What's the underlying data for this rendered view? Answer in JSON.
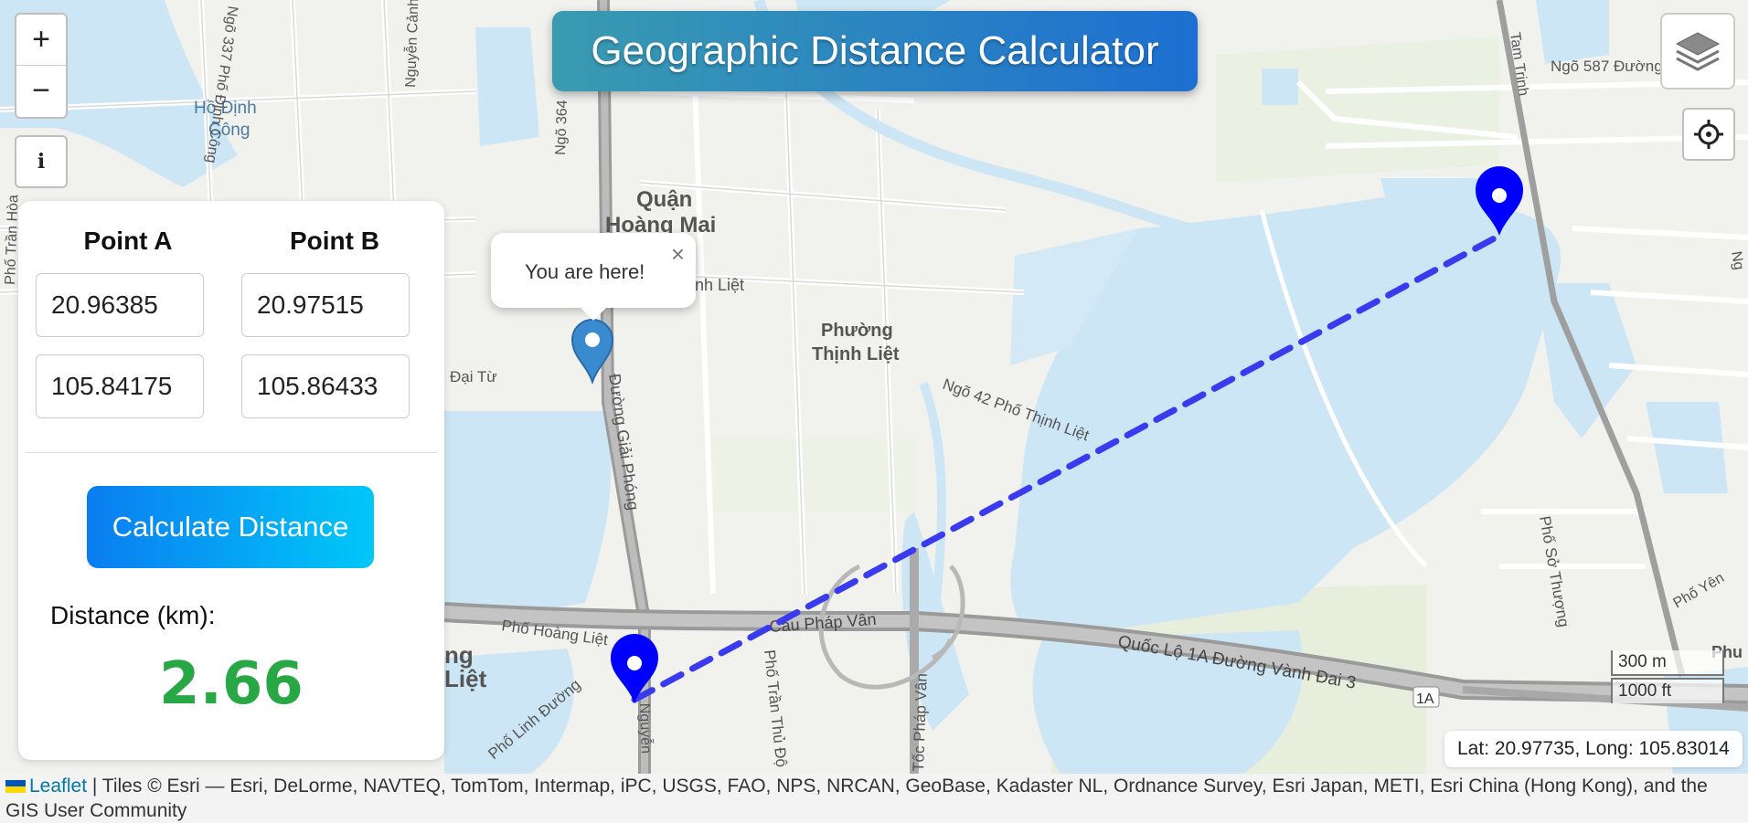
{
  "app": {
    "title": "Geographic Distance Calculator"
  },
  "map_controls": {
    "zoom_in": "+",
    "zoom_out": "−",
    "info": "i",
    "layers_icon": "layers-icon",
    "locate_icon": "crosshair-icon"
  },
  "form": {
    "point_a_label": "Point A",
    "point_b_label": "Point B",
    "point_a_lat": "20.96385",
    "point_a_lng": "105.84175",
    "point_b_lat": "20.97515",
    "point_b_lng": "105.86433",
    "calculate_label": "Calculate Distance",
    "distance_label": "Distance (km):",
    "distance_value": "2.66"
  },
  "popup": {
    "text": "You are here!",
    "close": "×"
  },
  "map_labels": {
    "quan_hoang_mai_1": "Quận",
    "quan_hoang_mai_2": "Hoàng Mai",
    "phuong_thinh_liet_1": "Phường",
    "phuong_thinh_liet_2": "Thịnh Liệt",
    "ho_dinh_cong_1": "Hồ Định",
    "ho_dinh_cong_2": "Công",
    "ngo_587": "Ngõ 587 Đường",
    "ngo_42": "Ngõ 42 Phố Thịnh Liệt",
    "duong_giai_phong": "Đường Giải Phóng",
    "cau_phap_van": "Cầu Pháp Vân",
    "quoc_lo_1a": "Quốc Lộ 1A Đường Vành Đai 3",
    "pho_hoang_liet": "Phố Hoàng Liệt",
    "pho_linh_duong": "Phố Linh Đường",
    "pho_tran_thu_do": "Phố Trần Thủ Độ",
    "toc_phap_van": "Tốc Pháp Vân",
    "pho_so_thuong": "Phố Sở Thượng",
    "dai_tu": "Đại Từ",
    "ngo_337": "Ngõ 337 Phố Định Công",
    "nguyen_canh_di": "Nguyễn Cảnh Dị",
    "pho_tran_hoa": "Phố Trần Hòa",
    "tam_trinh": "Tam Trinh",
    "ngo_364": "Ngõ 364",
    "badge_1a": "1A",
    "linh_liet": "nh Liệt",
    "ng_liet_1": "ng",
    "ng_liet_2": "Liệt",
    "pho_yen": "Phố Yên",
    "phu": "Phu",
    "ng_right": "Ng",
    "ng_bottom": "Nguyễn"
  },
  "scale": {
    "metric": "300 m",
    "imperial": "1000 ft"
  },
  "coords": {
    "text": "Lat: 20.97735, Long: 105.83014"
  },
  "attribution": {
    "leaflet": "Leaflet",
    "text": " | Tiles © Esri — Esri, DeLorme, NAVTEQ, TomTom, Intermap, iPC, USGS, FAO, NPS, NRCAN, GeoBase, Kadaster NL, Ordnance Survey, Esri Japan, METI, Esri China (Hong Kong), and the GIS User Community"
  },
  "colors": {
    "marker_blue": "#0000ff",
    "user_marker": "#3388cc",
    "line": "#3a3aef",
    "distance_green": "#28a745"
  }
}
